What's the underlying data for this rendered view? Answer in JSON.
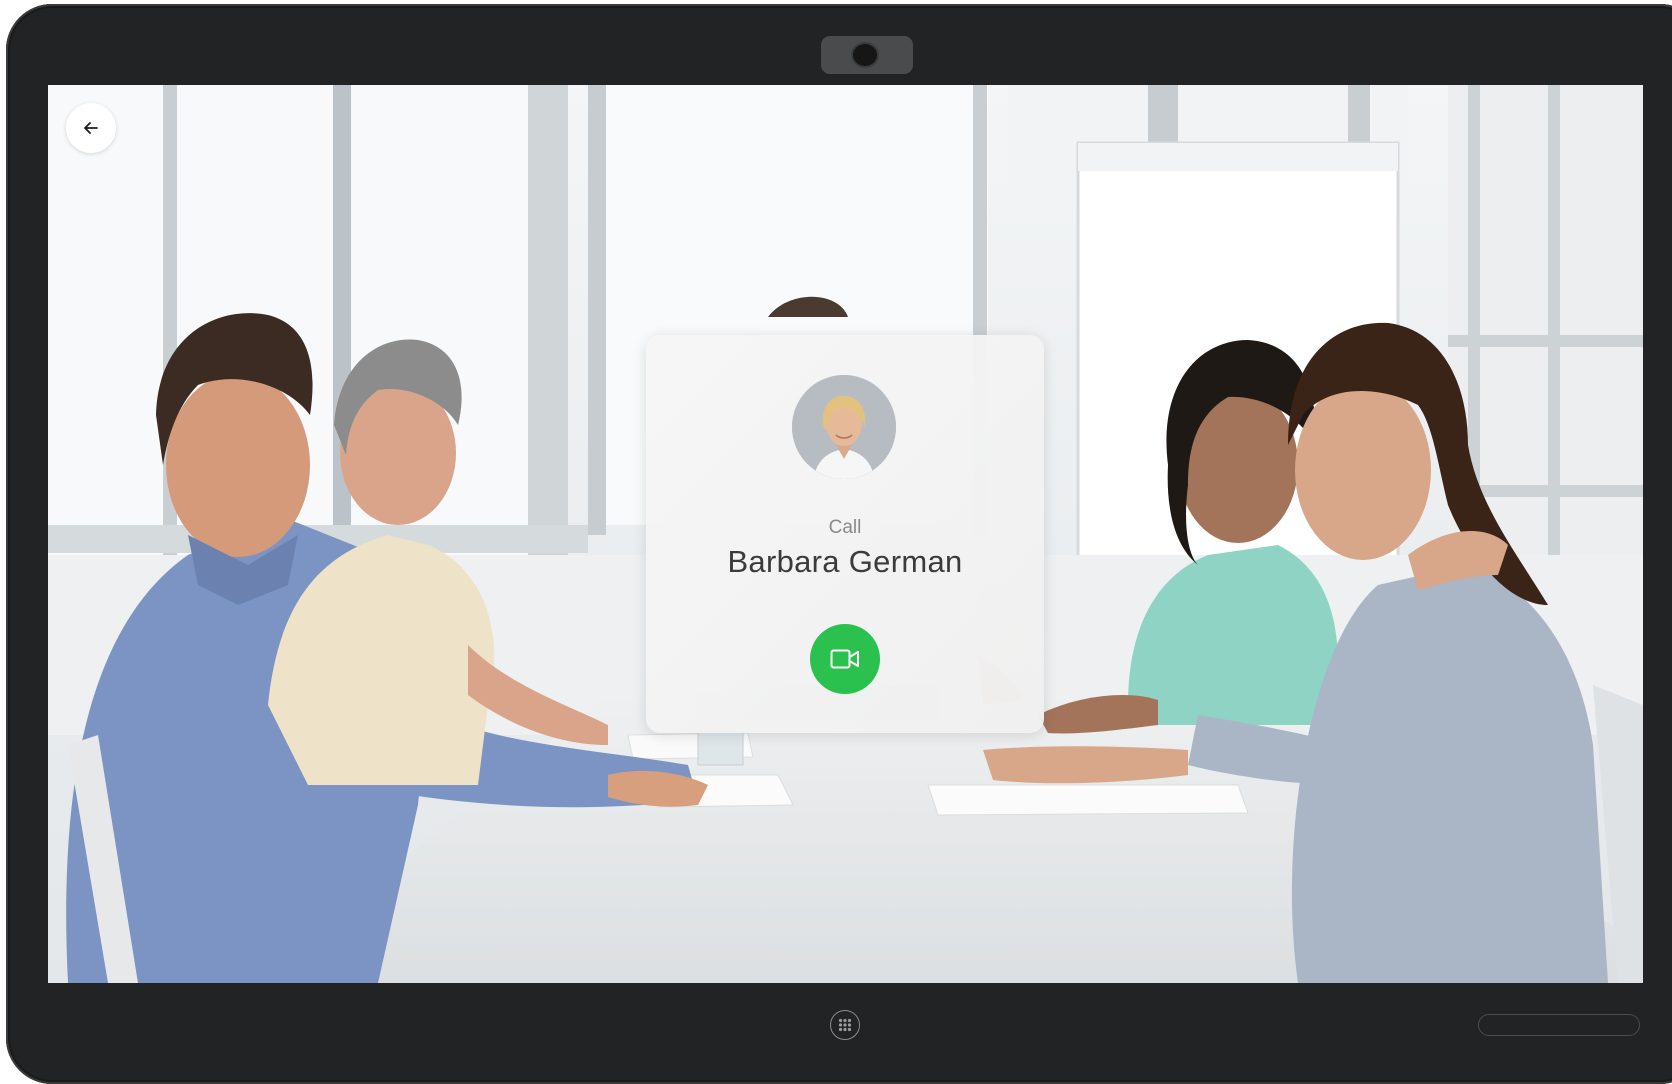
{
  "call_card": {
    "call_label": "Call",
    "contact_name": "Barbara German"
  },
  "colors": {
    "device_frame": "#222324",
    "card_background": "#f4f4f4",
    "call_button": "#2bc14f",
    "name_text": "#3b3b3b",
    "label_text": "#8a8a8a"
  },
  "icons": {
    "back": "arrow-left-icon",
    "video_call": "video-camera-icon",
    "home": "grid-dots-icon"
  }
}
